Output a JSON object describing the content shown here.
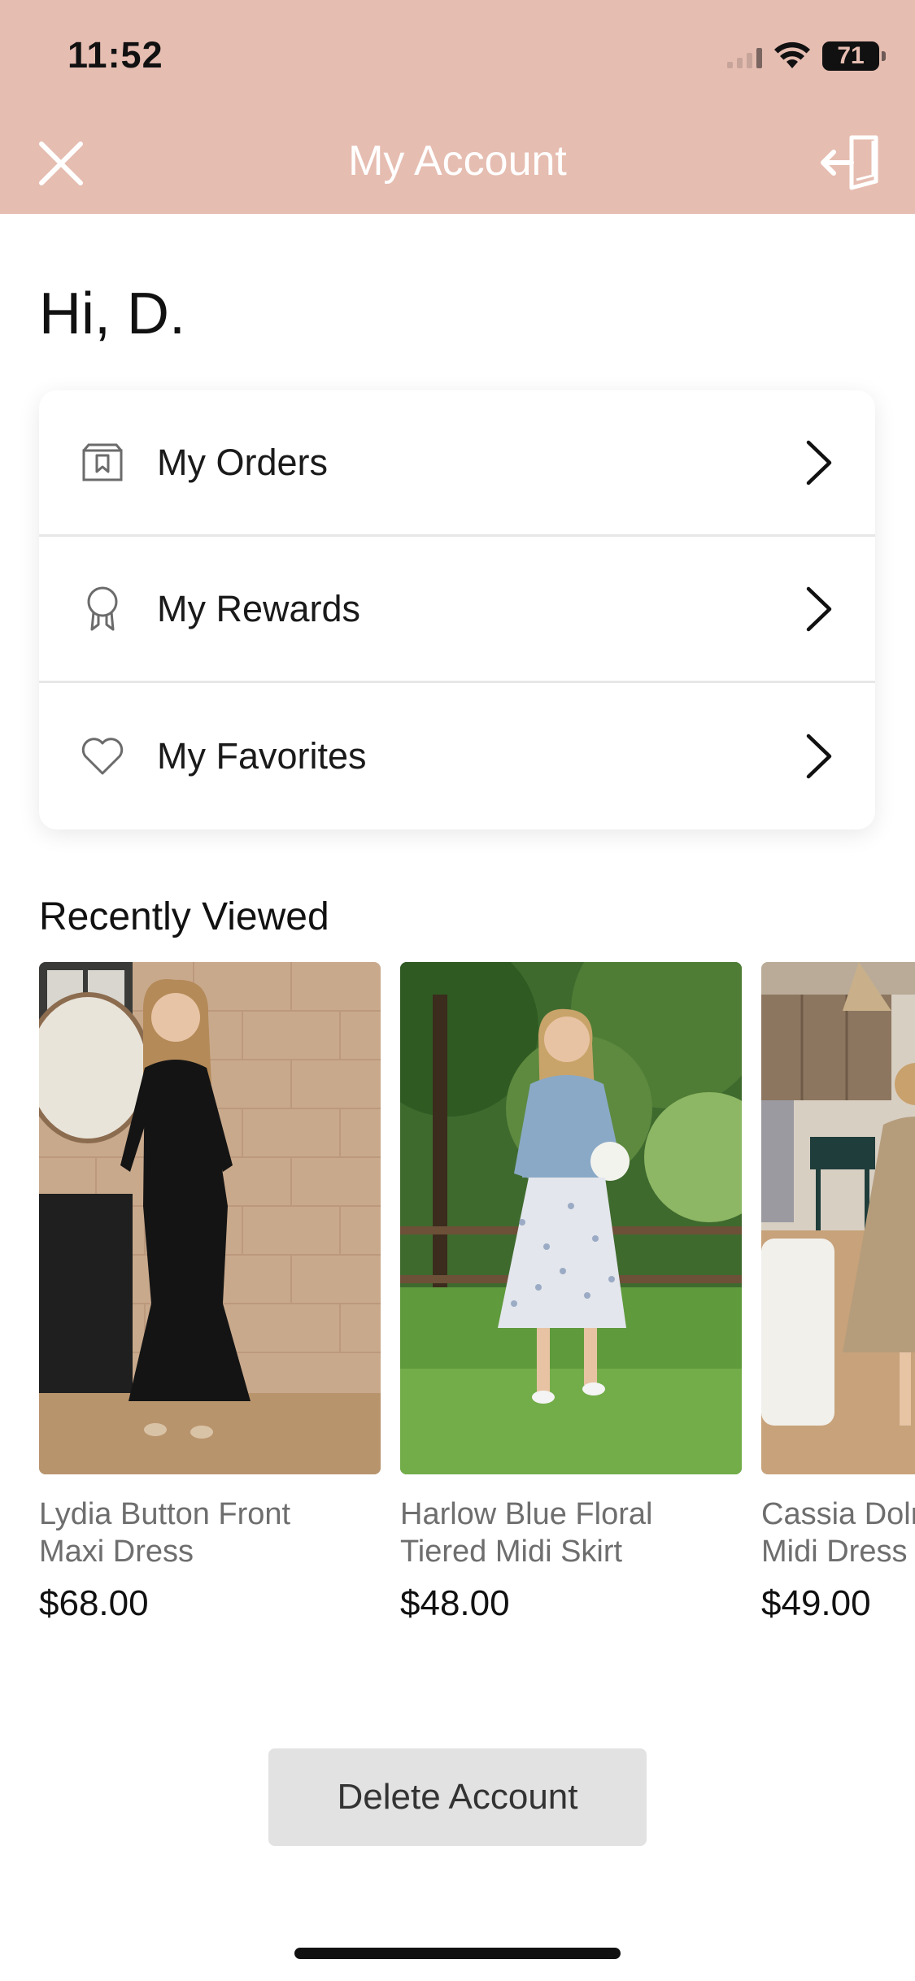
{
  "status_bar": {
    "time": "11:52",
    "battery": "71"
  },
  "header": {
    "title": "My Account",
    "close_icon": "close-icon",
    "logout_icon": "logout-icon"
  },
  "greeting": "Hi,  D.",
  "menu": {
    "items": [
      {
        "label": "My Orders",
        "icon": "box-icon"
      },
      {
        "label": "My Rewards",
        "icon": "ribbon-award-icon"
      },
      {
        "label": "My Favorites",
        "icon": "heart-icon"
      }
    ]
  },
  "recently_viewed": {
    "title": "Recently Viewed",
    "products": [
      {
        "name": "Lydia Button Front\nMaxi Dress",
        "price": "$68.00"
      },
      {
        "name": "Harlow Blue Floral\nTiered Midi Skirt",
        "price": "$48.00"
      },
      {
        "name": "Cassia Dolman\nMidi Dress",
        "price": "$49.00"
      }
    ]
  },
  "actions": {
    "delete_label": "Delete Account"
  },
  "colors": {
    "header_bg": "#e6bdb1",
    "header_text": "#ffffff",
    "button_bg": "#e2e2e2"
  }
}
